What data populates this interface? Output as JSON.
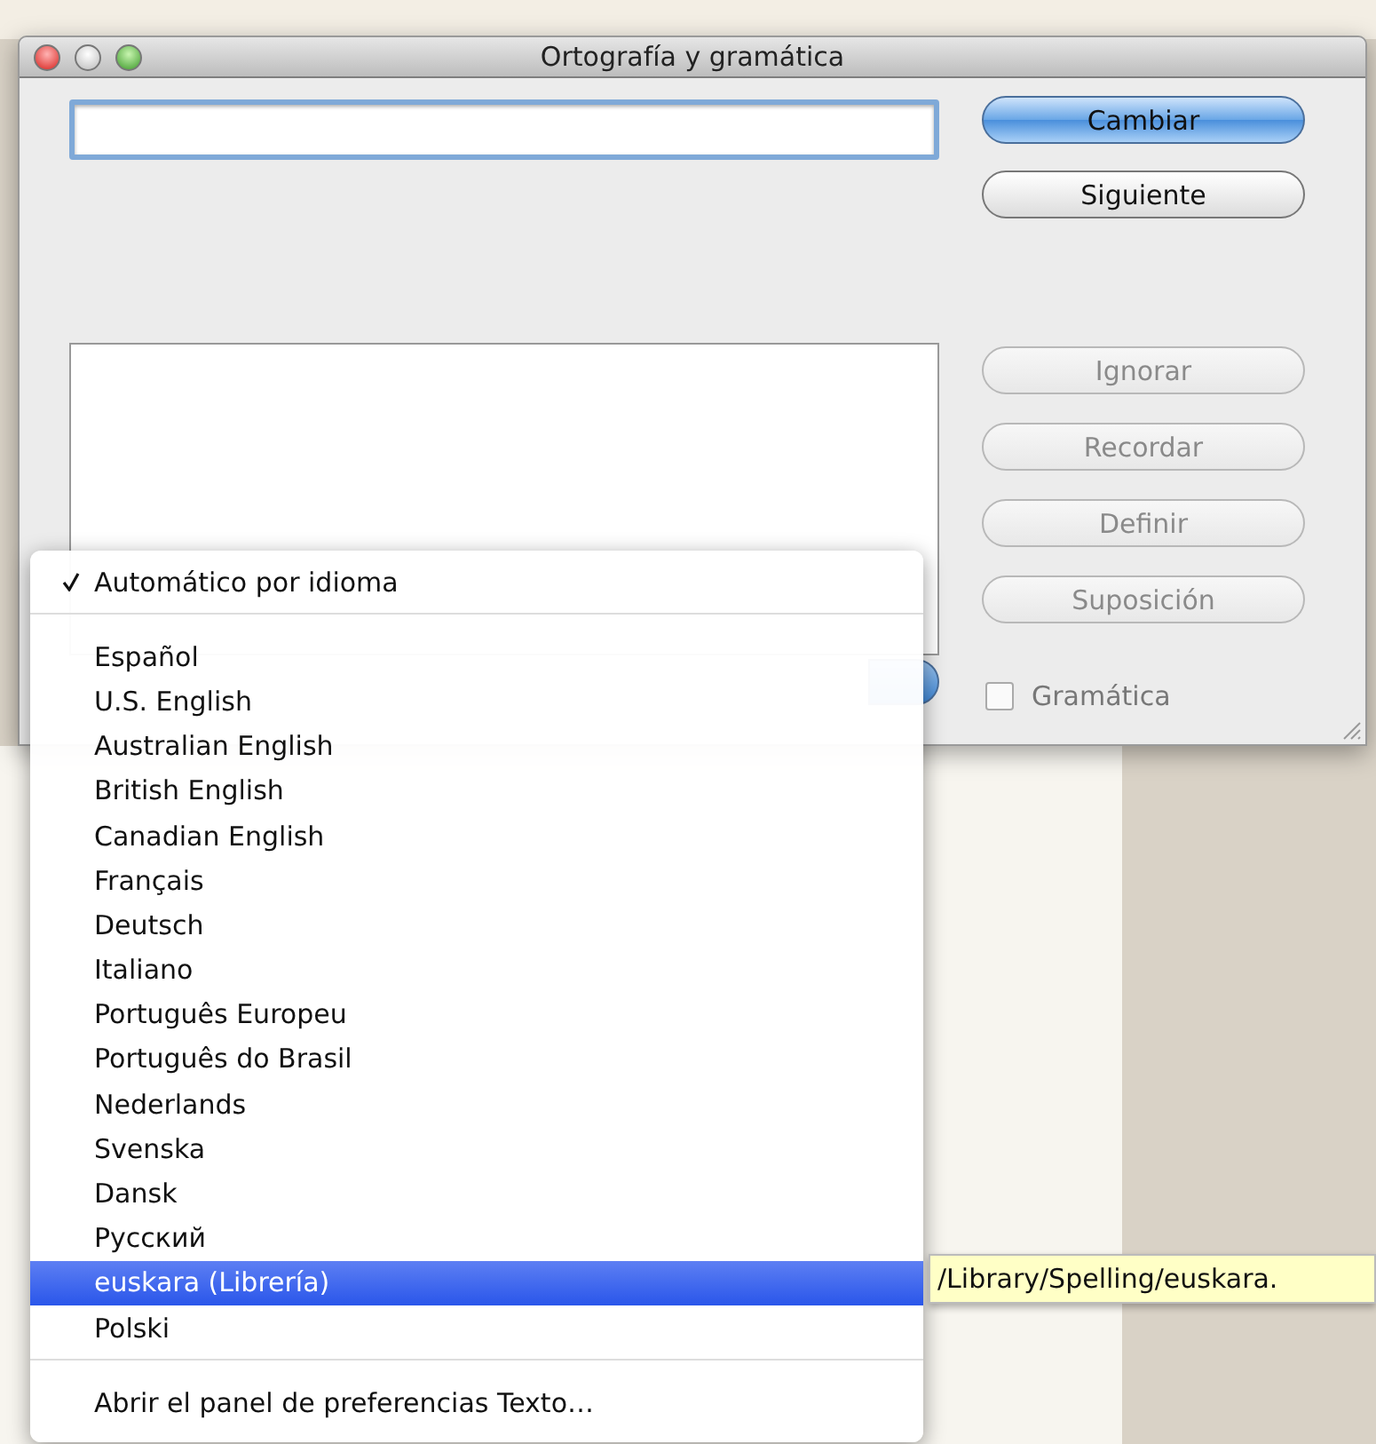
{
  "window": {
    "title": "Ortografía y gramática"
  },
  "buttons": [
    {
      "label": "Cambiar",
      "default": true,
      "disabled": false
    },
    {
      "label": "Siguiente",
      "default": false,
      "disabled": false
    }
  ],
  "side_buttons": [
    {
      "label": "Ignorar",
      "default": false,
      "disabled": true
    },
    {
      "label": "Recordar",
      "default": false,
      "disabled": true
    },
    {
      "label": "Definir",
      "default": false,
      "disabled": true
    },
    {
      "label": "Suposición",
      "default": false,
      "disabled": true
    }
  ],
  "grammar_checkbox": {
    "label": "Gramática",
    "checked": false
  },
  "language_menu": {
    "sections": [
      [
        {
          "label": "Automático por idioma",
          "checked": true,
          "selected": false
        }
      ],
      [
        {
          "label": "Español",
          "checked": false,
          "selected": false
        },
        {
          "label": "U.S. English",
          "checked": false,
          "selected": false
        },
        {
          "label": "Australian English",
          "checked": false,
          "selected": false
        },
        {
          "label": "British English",
          "checked": false,
          "selected": false
        },
        {
          "label": "Canadian English",
          "checked": false,
          "selected": false
        },
        {
          "label": "Français",
          "checked": false,
          "selected": false
        },
        {
          "label": "Deutsch",
          "checked": false,
          "selected": false
        },
        {
          "label": "Italiano",
          "checked": false,
          "selected": false
        },
        {
          "label": "Português Europeu",
          "checked": false,
          "selected": false
        },
        {
          "label": "Português do Brasil",
          "checked": false,
          "selected": false
        },
        {
          "label": "Nederlands",
          "checked": false,
          "selected": false
        },
        {
          "label": "Svenska",
          "checked": false,
          "selected": false
        },
        {
          "label": "Dansk",
          "checked": false,
          "selected": false
        },
        {
          "label": "Русский",
          "checked": false,
          "selected": false
        },
        {
          "label": "euskara (Librería)",
          "checked": false,
          "selected": true
        },
        {
          "label": "Polski",
          "checked": false,
          "selected": false
        }
      ],
      [
        {
          "label": "Abrir el panel de preferencias Texto…",
          "checked": false,
          "selected": false
        }
      ]
    ]
  },
  "tooltip": {
    "text": "/Library/Spelling/euskara."
  }
}
